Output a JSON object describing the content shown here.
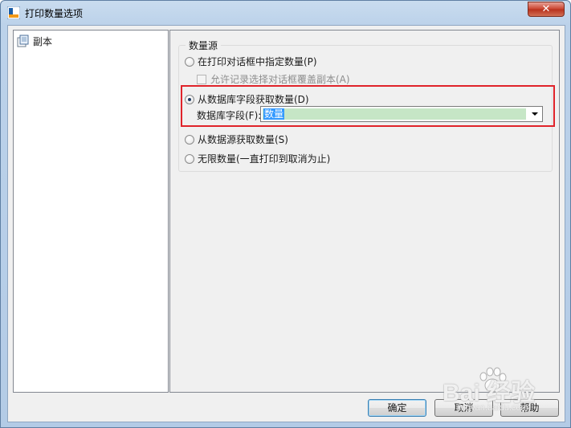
{
  "window": {
    "title": "打印数量选项",
    "close_label": "✕"
  },
  "tree": {
    "items": [
      {
        "label": "副本"
      }
    ]
  },
  "quantity_source": {
    "legend": "数量源",
    "options": [
      {
        "label": "在打印对话框中指定数量(P)",
        "checked": false
      },
      {
        "label": "从数据库字段获取数量(D)",
        "checked": true
      },
      {
        "label": "从数据源获取数量(S)",
        "checked": false
      },
      {
        "label": "无限数量(一直打印到取消为止)",
        "checked": false
      }
    ],
    "allow_override": {
      "label": "允许记录选择对话框覆盖副本(A)",
      "checked": false,
      "enabled": false
    },
    "db_field": {
      "label": "数据库字段(F):",
      "value": "数量"
    }
  },
  "buttons": {
    "ok": "确定",
    "cancel": "取消",
    "help": "帮助"
  },
  "watermark": {
    "text": "Bai 经验",
    "sub": "jingyan.baidu.com"
  },
  "colors": {
    "highlight_border": "#e0232a",
    "combo_fill": "#c6e6c6",
    "selection": "#3399ff"
  }
}
